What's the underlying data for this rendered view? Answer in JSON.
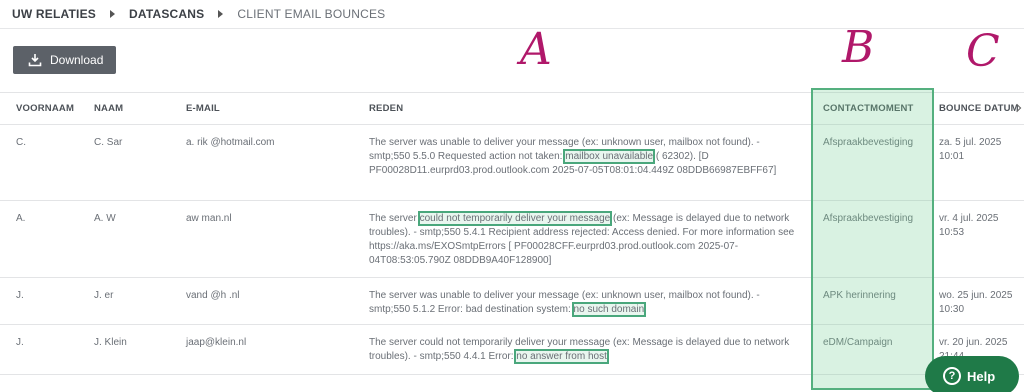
{
  "breadcrumb": {
    "items": [
      "UW RELATIES",
      "DATASCANS",
      "CLIENT EMAIL BOUNCES"
    ]
  },
  "toolbar": {
    "download_label": "Download",
    "download_icon": "download-icon"
  },
  "annotations": [
    "A",
    "B",
    "C"
  ],
  "table": {
    "headers": [
      "VOORNAAM",
      "NAAM",
      "E-MAIL",
      "REDEN",
      "CONTACTMOMENT",
      "BOUNCE DATUM"
    ],
    "rows": [
      {
        "voornaam": "C.",
        "naam": "C. Sar",
        "email": "a. rik  @hotmail.com",
        "reden_before": "The server was unable to deliver your message (ex: unknown user, mailbox not found). - smtp;550 5.5.0 Requested action not taken: ",
        "reden_highlight": "mailbox unavailable",
        "reden_after": " (  62302). [D   PF00028D11.eurprd03.prod.outlook.com 2025-07-05T08:01:04.449Z 08DDB66987EBFF67]",
        "contact": "Afspraakbevestiging",
        "bounce": "za. 5 jul. 2025 10:01"
      },
      {
        "voornaam": "A.",
        "naam": "A. W",
        "email": "aw    man.nl",
        "reden_before": "The server ",
        "reden_highlight": "could not temporarily deliver your message",
        "reden_after": " (ex: Message is delayed due to network troubles). - smtp;550 5.4.1 Recipient address rejected: Access denied. For more information see https://aka.ms/EXOSmtpErrors [  PF00028CFF.eurprd03.prod.outlook.com 2025-07-04T08:53:05.790Z 08DDB9A40F128900]",
        "contact": "Afspraakbevestiging",
        "bounce": "vr. 4 jul. 2025 10:53"
      },
      {
        "voornaam": "J.",
        "naam": "J.  er",
        "email": "vand   @h   .nl",
        "reden_before": "The server was unable to deliver your message (ex: unknown user, mailbox not found). - smtp;550 5.1.2 Error: bad destination system: ",
        "reden_highlight": "no such domain",
        "reden_after": "",
        "contact": "APK herinnering",
        "bounce": "wo. 25 jun. 2025 10:30"
      },
      {
        "voornaam": "J.",
        "naam": "J. Klein",
        "email": "jaap@klein.nl",
        "reden_before": "The server could not temporarily deliver your message (ex: Message is delayed due to network troubles). - smtp;550 4.4.1 Error: ",
        "reden_highlight": "no answer from host",
        "reden_after": "",
        "contact": "eDM/Campaign",
        "bounce": "vr. 20 jun. 2025 21:44"
      }
    ]
  },
  "help": {
    "label": "Help",
    "icon": "help-icon"
  },
  "colors": {
    "button_bg": "#5c6168",
    "annotation": "#b0186a",
    "highlight": "#4aa77c",
    "help_bg": "#1f7a48"
  }
}
